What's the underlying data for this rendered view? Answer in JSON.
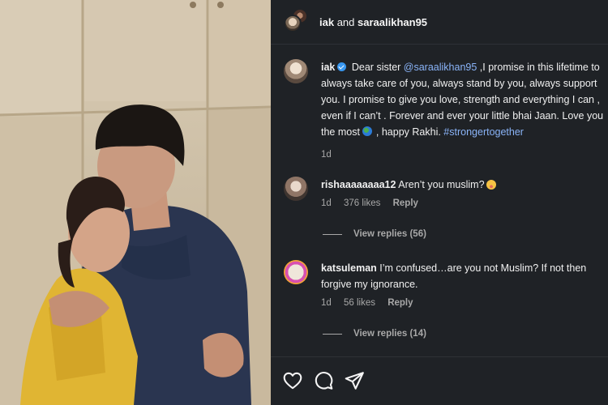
{
  "header": {
    "user1": "iak",
    "connector": "and",
    "user2": "saraalikhan95"
  },
  "caption": {
    "username": "iak",
    "text_before_mention": "Dear sister ",
    "mention": "@saraalikhan95",
    "text_main": " ,I promise in this lifetime to always take care of you, always stand by you, always support you. I promise to give you love, strength and everything I can , even if I can’t . Forever and ever your little bhai Jaan. Love you the most ",
    "text_after_emoji": ", happy Rakhi. ",
    "hashtag": "#strongertogether",
    "time": "1d"
  },
  "comments": [
    {
      "username": "rishaaaaaaaa12",
      "text": "Aren’t you muslim?",
      "time": "1d",
      "likes": "376 likes",
      "reply_label": "Reply",
      "view_replies": "View replies (56)"
    },
    {
      "username": "katsuleman",
      "text": "I’m confused…are you not Muslim? If not then forgive my ignorance.",
      "time": "1d",
      "likes": "56 likes",
      "reply_label": "Reply",
      "view_replies": "View replies (14)"
    }
  ],
  "actions": [
    "heart-icon",
    "comment-icon",
    "share-icon"
  ],
  "colors": {
    "panel_bg": "#1f2226",
    "link": "#8ab4f8",
    "verified": "#3897f0",
    "muted": "#a8a8a8"
  }
}
